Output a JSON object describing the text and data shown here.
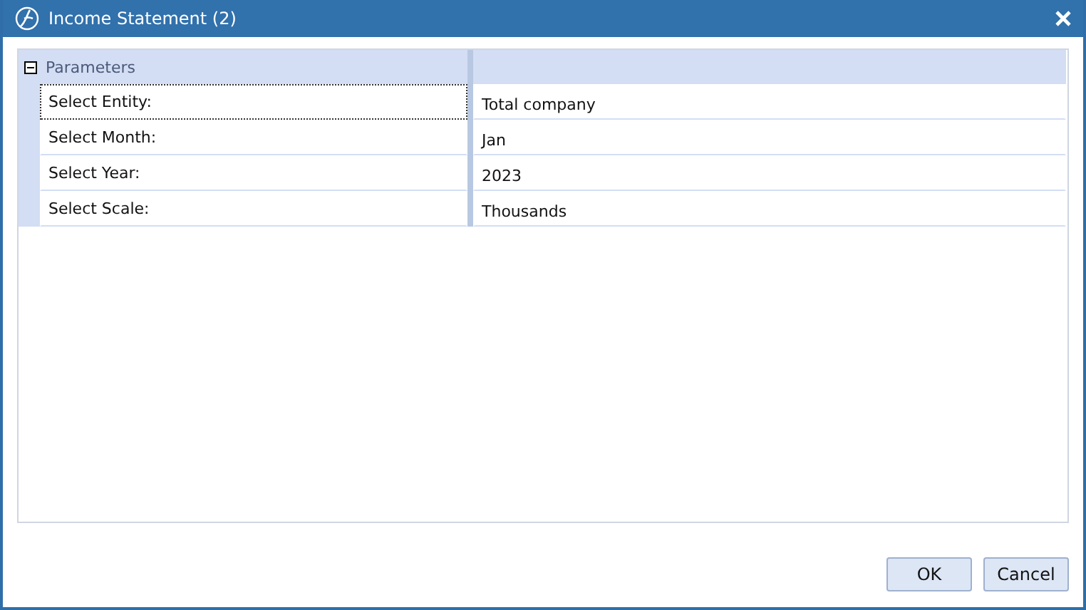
{
  "window": {
    "title": "Income Statement (2)"
  },
  "parameters": {
    "title": "Parameters",
    "expanded": true,
    "rows": [
      {
        "label": "Select Entity:",
        "value": "Total company",
        "focused": true
      },
      {
        "label": "Select Month:",
        "value": "Jan",
        "focused": false
      },
      {
        "label": "Select Year:",
        "value": "2023",
        "focused": false
      },
      {
        "label": "Select Scale:",
        "value": "Thousands",
        "focused": false
      }
    ]
  },
  "buttons": [
    "OK",
    "Cancel"
  ]
}
